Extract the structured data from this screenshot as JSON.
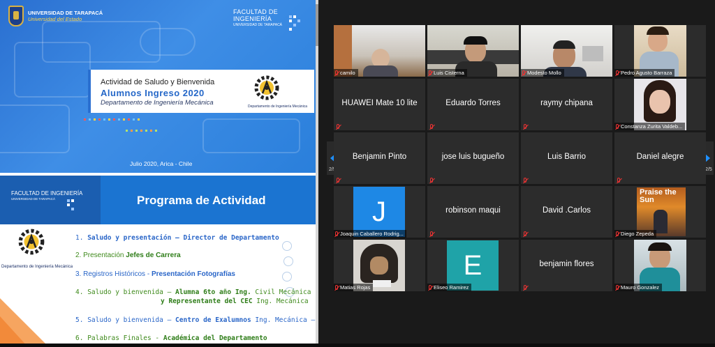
{
  "slides": {
    "slide1": {
      "uni_name": "UNIVERSIDAD DE TARAPACÁ",
      "uni_sub": "Universidad del Estado",
      "faculty": "FACULTAD DE INGENIERÍA",
      "faculty_sub": "UNIVERSIDAD DE TARAPACÁ",
      "title_l1": "Actividad de Saludo y Bienvenida",
      "title_l2": "Alumnos Ingreso 2020",
      "title_l3": "Departamento de Ingeniería Mecánica",
      "dept_caption": "Departamento de Ingeniería Mecánica",
      "date": "Julio 2020, Arica - Chile"
    },
    "slide2": {
      "faculty": "FACULTAD DE INGENIERÍA",
      "faculty_sub": "UNIVERSIDAD DE TARAPACÁ",
      "title": "Programa de Actividad",
      "dept_caption": "Departamento de Ingeniería Mecánica",
      "items": [
        {
          "num": "1.",
          "a": "Saludo y presentación",
          "sep": " – ",
          "b": "Director de Departamento"
        },
        {
          "num": "2.",
          "a": "Presentación",
          "sep": " ",
          "b": "Jefes de Carrera"
        },
        {
          "num": "3.",
          "a": "Registros Históricos",
          "sep": " - ",
          "b": "Presentación Fotografías"
        },
        {
          "num": "4.",
          "a": "Saludo y bienvenida",
          "sep": " – ",
          "b": "Alumna 6to año Ing.",
          "c": " Civil Mecánica"
        },
        {
          "num": "",
          "a": "",
          "sep": "",
          "b": "y Representante del CEC",
          "c": " Ing. Mecánica"
        },
        {
          "num": "5.",
          "a": "Saludo y bienvenida",
          "sep": " – ",
          "b": "Centro de Exalumnos",
          "c": " Ing. Mecánica – UTA"
        },
        {
          "num": "6.",
          "a": "Palabras Finales",
          "sep": "  - ",
          "b": "Académica del Departamento"
        }
      ]
    }
  },
  "gallery": {
    "page_label_left": "2/5",
    "page_label_right": "2/5",
    "participants": [
      {
        "name": "camilo",
        "type": "video",
        "muted": true
      },
      {
        "name": "Luis Cisterna",
        "type": "video",
        "muted": true
      },
      {
        "name": "Modesto Mollo",
        "type": "video",
        "muted": true
      },
      {
        "name": "Pedro Agusto Barraza",
        "type": "video",
        "muted": true
      },
      {
        "name": "HUAWEI Mate 10 lite",
        "type": "name",
        "muted": true
      },
      {
        "name": "Eduardo Torres",
        "type": "name",
        "muted": true
      },
      {
        "name": "raymy chipana",
        "type": "name",
        "muted": true
      },
      {
        "name": "Constanza Zurita Valdeb...",
        "type": "video",
        "muted": true
      },
      {
        "name": "Benjamin Pinto",
        "type": "name",
        "muted": true
      },
      {
        "name": "jose luis bugueño",
        "type": "name",
        "muted": true
      },
      {
        "name": "Luis Barrio",
        "type": "name",
        "muted": true
      },
      {
        "name": "Daniel alegre",
        "type": "name",
        "muted": true
      },
      {
        "name": "Joaquin Caballero Rodrig...",
        "type": "avatar",
        "initial": "J",
        "color": "#1e88e5",
        "muted": true
      },
      {
        "name": "robinson maqui",
        "type": "name",
        "muted": true
      },
      {
        "name": "David .Carlos",
        "type": "name",
        "muted": true
      },
      {
        "name": "Diego Zepeda",
        "type": "image",
        "image_text": "Praise the Sun",
        "muted": true
      },
      {
        "name": "Matias Rojas",
        "type": "image",
        "muted": true
      },
      {
        "name": "Eliseo Ramirez",
        "type": "avatar",
        "initial": "E",
        "color": "#1fa3a8",
        "muted": true
      },
      {
        "name": "benjamin flores",
        "type": "name",
        "muted": true
      },
      {
        "name": "Mauro Gonzalez",
        "type": "video",
        "muted": true
      }
    ]
  }
}
